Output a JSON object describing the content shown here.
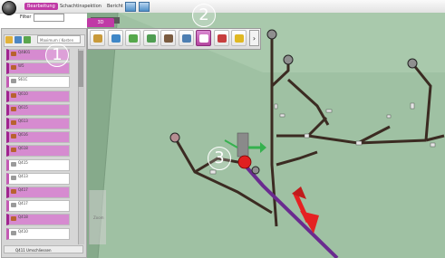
{
  "menu": {
    "tabs": [
      "Bearbeitung",
      "Schachtinspektion",
      "Bericht"
    ],
    "filter_label": "Filter",
    "filter_value": ""
  },
  "panel": {
    "search_placeholder": "Maximum / Kosten",
    "items": [
      {
        "label": "Q4801",
        "sel": true
      },
      {
        "label": "W5",
        "sel": true
      },
      {
        "label": "S61C",
        "sel": false
      },
      {
        "label": "Q610",
        "sel": true
      },
      {
        "label": "Q615",
        "sel": true
      },
      {
        "label": "Q613",
        "sel": true
      },
      {
        "label": "Q616",
        "sel": true
      },
      {
        "label": "Q618",
        "sel": true
      },
      {
        "label": "Q415",
        "sel": false
      },
      {
        "label": "Q413",
        "sel": false
      },
      {
        "label": "Q417",
        "sel": true
      },
      {
        "label": "Q417",
        "sel": false
      },
      {
        "label": "Q418",
        "sel": true
      },
      {
        "label": "Q410",
        "sel": false
      }
    ],
    "footer_label": "Q411 Umschliessen"
  },
  "view": {
    "tab_label": "3D",
    "side_label": "Zoom",
    "toolbar_buttons": [
      {
        "name": "hand-icon",
        "color": "#c99a3a",
        "active": false
      },
      {
        "name": "rotate-icon",
        "color": "#3f87c7",
        "active": false
      },
      {
        "name": "route-icon",
        "color": "#56a84c",
        "active": false
      },
      {
        "name": "pipe-icon",
        "color": "#4f9d52",
        "active": false
      },
      {
        "name": "node-icon",
        "color": "#7a5b3f",
        "active": false
      },
      {
        "name": "split-icon",
        "color": "#4e7fb2",
        "active": false
      },
      {
        "name": "edit-pipe-icon",
        "color": "#ffffff",
        "active": true
      },
      {
        "name": "draw-icon",
        "color": "#c73e3e",
        "active": false
      },
      {
        "name": "info-icon",
        "color": "#e0b822",
        "active": false
      }
    ]
  },
  "callouts": [
    "1",
    "2",
    "3"
  ],
  "colors": {
    "accent": "#c03aa6",
    "view_bg": "#9fc1a3",
    "pipe": "#3b2b22",
    "selected_pipe": "#6a2b8f",
    "arrow": "#e52222"
  }
}
